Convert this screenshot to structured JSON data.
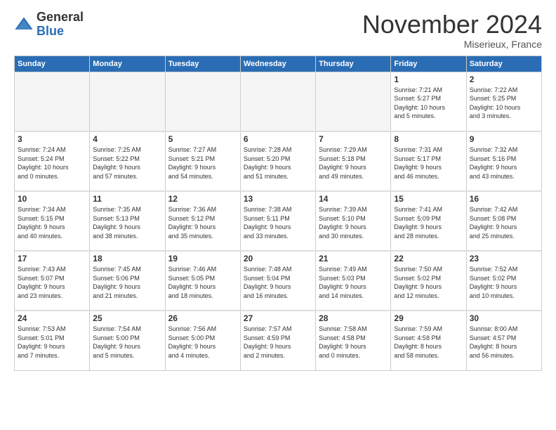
{
  "header": {
    "logo_general": "General",
    "logo_blue": "Blue",
    "month_title": "November 2024",
    "location": "Miserieux, France"
  },
  "weekdays": [
    "Sunday",
    "Monday",
    "Tuesday",
    "Wednesday",
    "Thursday",
    "Friday",
    "Saturday"
  ],
  "weeks": [
    [
      {
        "day": "",
        "info": ""
      },
      {
        "day": "",
        "info": ""
      },
      {
        "day": "",
        "info": ""
      },
      {
        "day": "",
        "info": ""
      },
      {
        "day": "",
        "info": ""
      },
      {
        "day": "1",
        "info": "Sunrise: 7:21 AM\nSunset: 5:27 PM\nDaylight: 10 hours\nand 5 minutes."
      },
      {
        "day": "2",
        "info": "Sunrise: 7:22 AM\nSunset: 5:25 PM\nDaylight: 10 hours\nand 3 minutes."
      }
    ],
    [
      {
        "day": "3",
        "info": "Sunrise: 7:24 AM\nSunset: 5:24 PM\nDaylight: 10 hours\nand 0 minutes."
      },
      {
        "day": "4",
        "info": "Sunrise: 7:25 AM\nSunset: 5:22 PM\nDaylight: 9 hours\nand 57 minutes."
      },
      {
        "day": "5",
        "info": "Sunrise: 7:27 AM\nSunset: 5:21 PM\nDaylight: 9 hours\nand 54 minutes."
      },
      {
        "day": "6",
        "info": "Sunrise: 7:28 AM\nSunset: 5:20 PM\nDaylight: 9 hours\nand 51 minutes."
      },
      {
        "day": "7",
        "info": "Sunrise: 7:29 AM\nSunset: 5:18 PM\nDaylight: 9 hours\nand 49 minutes."
      },
      {
        "day": "8",
        "info": "Sunrise: 7:31 AM\nSunset: 5:17 PM\nDaylight: 9 hours\nand 46 minutes."
      },
      {
        "day": "9",
        "info": "Sunrise: 7:32 AM\nSunset: 5:16 PM\nDaylight: 9 hours\nand 43 minutes."
      }
    ],
    [
      {
        "day": "10",
        "info": "Sunrise: 7:34 AM\nSunset: 5:15 PM\nDaylight: 9 hours\nand 40 minutes."
      },
      {
        "day": "11",
        "info": "Sunrise: 7:35 AM\nSunset: 5:13 PM\nDaylight: 9 hours\nand 38 minutes."
      },
      {
        "day": "12",
        "info": "Sunrise: 7:36 AM\nSunset: 5:12 PM\nDaylight: 9 hours\nand 35 minutes."
      },
      {
        "day": "13",
        "info": "Sunrise: 7:38 AM\nSunset: 5:11 PM\nDaylight: 9 hours\nand 33 minutes."
      },
      {
        "day": "14",
        "info": "Sunrise: 7:39 AM\nSunset: 5:10 PM\nDaylight: 9 hours\nand 30 minutes."
      },
      {
        "day": "15",
        "info": "Sunrise: 7:41 AM\nSunset: 5:09 PM\nDaylight: 9 hours\nand 28 minutes."
      },
      {
        "day": "16",
        "info": "Sunrise: 7:42 AM\nSunset: 5:08 PM\nDaylight: 9 hours\nand 25 minutes."
      }
    ],
    [
      {
        "day": "17",
        "info": "Sunrise: 7:43 AM\nSunset: 5:07 PM\nDaylight: 9 hours\nand 23 minutes."
      },
      {
        "day": "18",
        "info": "Sunrise: 7:45 AM\nSunset: 5:06 PM\nDaylight: 9 hours\nand 21 minutes."
      },
      {
        "day": "19",
        "info": "Sunrise: 7:46 AM\nSunset: 5:05 PM\nDaylight: 9 hours\nand 18 minutes."
      },
      {
        "day": "20",
        "info": "Sunrise: 7:48 AM\nSunset: 5:04 PM\nDaylight: 9 hours\nand 16 minutes."
      },
      {
        "day": "21",
        "info": "Sunrise: 7:49 AM\nSunset: 5:03 PM\nDaylight: 9 hours\nand 14 minutes."
      },
      {
        "day": "22",
        "info": "Sunrise: 7:50 AM\nSunset: 5:02 PM\nDaylight: 9 hours\nand 12 minutes."
      },
      {
        "day": "23",
        "info": "Sunrise: 7:52 AM\nSunset: 5:02 PM\nDaylight: 9 hours\nand 10 minutes."
      }
    ],
    [
      {
        "day": "24",
        "info": "Sunrise: 7:53 AM\nSunset: 5:01 PM\nDaylight: 9 hours\nand 7 minutes."
      },
      {
        "day": "25",
        "info": "Sunrise: 7:54 AM\nSunset: 5:00 PM\nDaylight: 9 hours\nand 5 minutes."
      },
      {
        "day": "26",
        "info": "Sunrise: 7:56 AM\nSunset: 5:00 PM\nDaylight: 9 hours\nand 4 minutes."
      },
      {
        "day": "27",
        "info": "Sunrise: 7:57 AM\nSunset: 4:59 PM\nDaylight: 9 hours\nand 2 minutes."
      },
      {
        "day": "28",
        "info": "Sunrise: 7:58 AM\nSunset: 4:58 PM\nDaylight: 9 hours\nand 0 minutes."
      },
      {
        "day": "29",
        "info": "Sunrise: 7:59 AM\nSunset: 4:58 PM\nDaylight: 8 hours\nand 58 minutes."
      },
      {
        "day": "30",
        "info": "Sunrise: 8:00 AM\nSunset: 4:57 PM\nDaylight: 8 hours\nand 56 minutes."
      }
    ]
  ]
}
